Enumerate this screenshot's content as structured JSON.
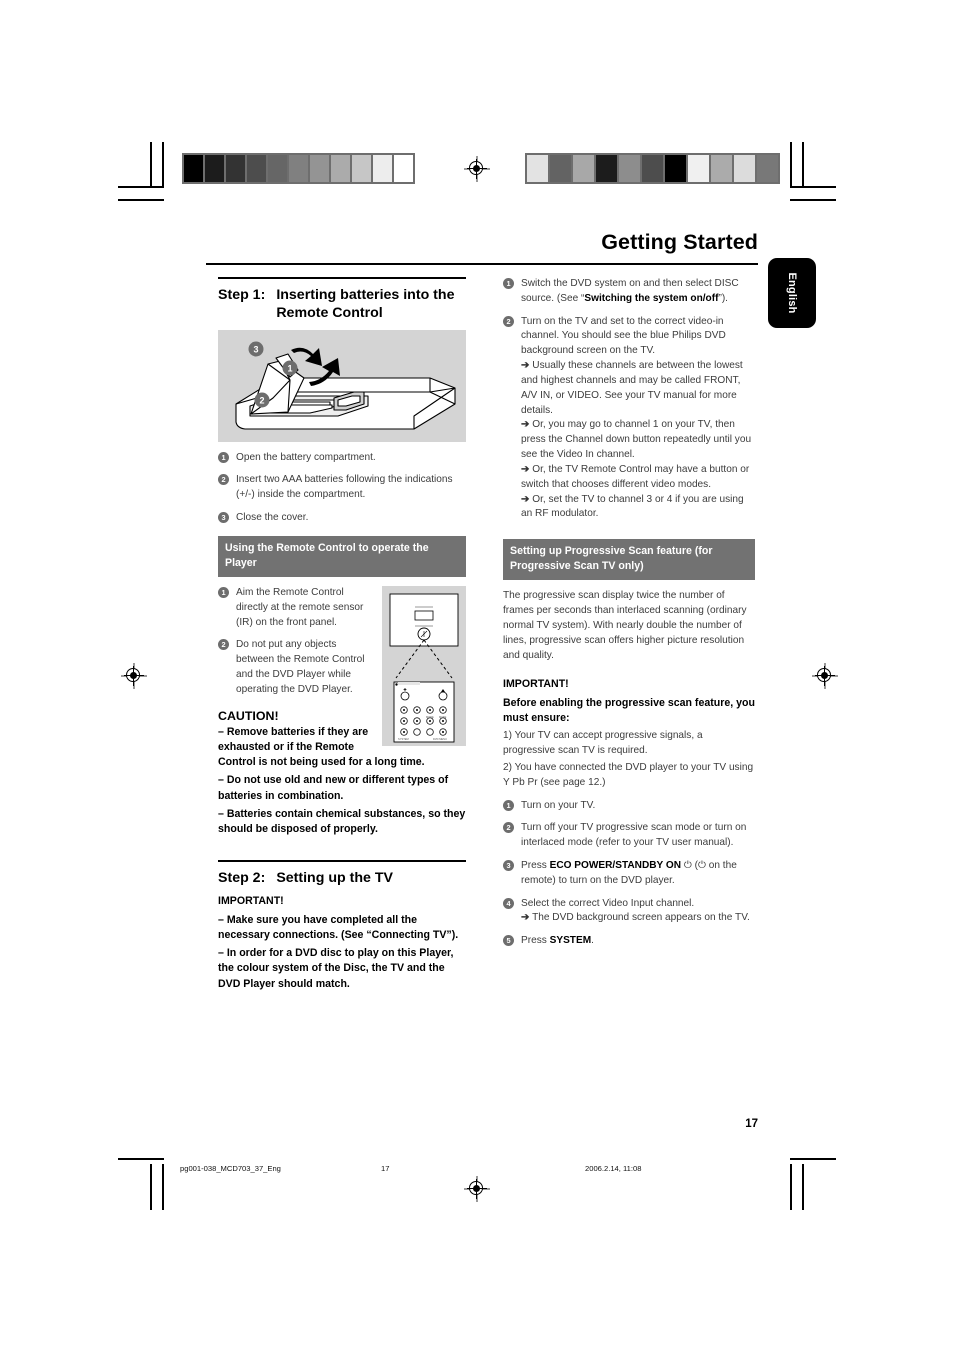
{
  "header": {
    "title": "Getting Started",
    "language_tab": "English"
  },
  "calibration_left": [
    "#000000",
    "#1c1c1c",
    "#333333",
    "#4d4d4d",
    "#666666",
    "#808080",
    "#949494",
    "#ababab",
    "#c6c6c6",
    "#ededed",
    "#ffffff"
  ],
  "calibration_right": [
    "#e3e3e3",
    "#636363",
    "#a8a8a8",
    "#1c1c1c",
    "#8d8d8d",
    "#4d4d4d",
    "#000000",
    "#f0f0f0",
    "#ababab",
    "#dcdcdc",
    "#787878"
  ],
  "left_column": {
    "step1": {
      "label": "Step 1:",
      "title": "Inserting batteries into the Remote Control",
      "figure_callouts": [
        "3",
        "1",
        "2"
      ],
      "items": [
        {
          "num": "1",
          "text": "Open the battery compartment."
        },
        {
          "num": "2",
          "text": "Insert two AAA batteries following the indications (+/-) inside the compartment."
        },
        {
          "num": "3",
          "text": "Close the cover."
        }
      ]
    },
    "remote_section": {
      "bar": "Using the Remote Control to operate the Player",
      "items": [
        {
          "num": "1",
          "text": "Aim the Remote Control directly at the remote sensor (IR) on the front panel."
        },
        {
          "num": "2",
          "text": "Do not put any objects between the Remote Control and the DVD Player while operating the DVD Player."
        }
      ],
      "caution_heading": "CAUTION!",
      "caution_lines": [
        "–  Remove batteries if they are exhausted or if the Remote Control is not being used for a long time.",
        "–  Do not use old and new or different types of batteries in combination.",
        "–  Batteries contain chemical substances, so they should be disposed of properly."
      ]
    },
    "step2": {
      "label": "Step 2:",
      "title": "Setting up the TV",
      "important_heading": "IMPORTANT!",
      "important_lines": [
        "–  Make sure you have completed all the necessary connections. (See “Connecting TV”).",
        "–  In order for a DVD disc to play on this Player, the colour system of the Disc, the TV and the DVD Player should match."
      ]
    }
  },
  "right_column": {
    "items": [
      {
        "num": "1",
        "text_parts": [
          {
            "t": "Switch the DVD system on and then select DISC source. (See “",
            "b": false
          },
          {
            "t": "Switching the system on/off",
            "b": true
          },
          {
            "t": "”).",
            "b": false
          }
        ]
      },
      {
        "num": "2",
        "text": "Turn on the TV and set to the correct video-in channel. You should see the blue Philips DVD background screen on the TV.",
        "subs": [
          "Usually these channels are between the lowest and highest channels and may be called FRONT, A/V IN, or VIDEO. See your TV manual for more details.",
          "Or, you may go to channel 1 on your TV, then press the Channel down button repeatedly until you see the Video In channel.",
          "Or, the TV Remote Control may have a button or switch that chooses different video modes.",
          "Or, set the TV to channel 3 or 4 if you are using an RF modulator."
        ]
      }
    ],
    "progressive": {
      "bar": "Setting up Progressive Scan feature (for Progressive Scan TV only)",
      "paragraph": "The progressive scan display twice the number of frames per seconds than interlaced scanning (ordinary normal TV system). With nearly double the number of lines, progressive scan offers higher picture resolution and quality.",
      "important_heading": "IMPORTANT!",
      "important_bold": "Before enabling the progressive scan feature, you must ensure:",
      "ensure_lines": [
        "1) Your TV can accept progressive signals, a progressive scan TV is required.",
        "2) You have connected the DVD player to your TV using Y Pb Pr (see page 12.)"
      ],
      "items": [
        {
          "num": "1",
          "text": "Turn on your TV."
        },
        {
          "num": "2",
          "text": "Turn off your TV progressive scan mode or turn on interlaced mode (refer to your TV user manual)."
        },
        {
          "num": "3",
          "text_parts": [
            {
              "t": "Press ",
              "b": false
            },
            {
              "t": "ECO POWER/STANDBY ON",
              "b": true
            },
            {
              "t": " ⏻ (⏻ on the remote) to turn on the DVD player.",
              "b": false
            }
          ]
        },
        {
          "num": "4",
          "text": "Select the correct Video Input channel.",
          "subs": [
            "The DVD background screen appears on the TV."
          ]
        },
        {
          "num": "5",
          "text_parts": [
            {
              "t": "Press ",
              "b": false
            },
            {
              "t": "SYSTEM",
              "b": true
            },
            {
              "t": ".",
              "b": false
            }
          ]
        }
      ]
    }
  },
  "footer": {
    "page_number": "17",
    "file_name": "pg001-038_MCD703_37_Eng",
    "sheet_number": "17",
    "timestamp": "2006.2.14, 11:08"
  },
  "colors": {
    "section_bar": "#727272",
    "bullet_circle": "#6d6d6d",
    "figure_bg": "#d4d4d4",
    "body_text": "#3c3c3c",
    "tab_bg": "#000000"
  }
}
